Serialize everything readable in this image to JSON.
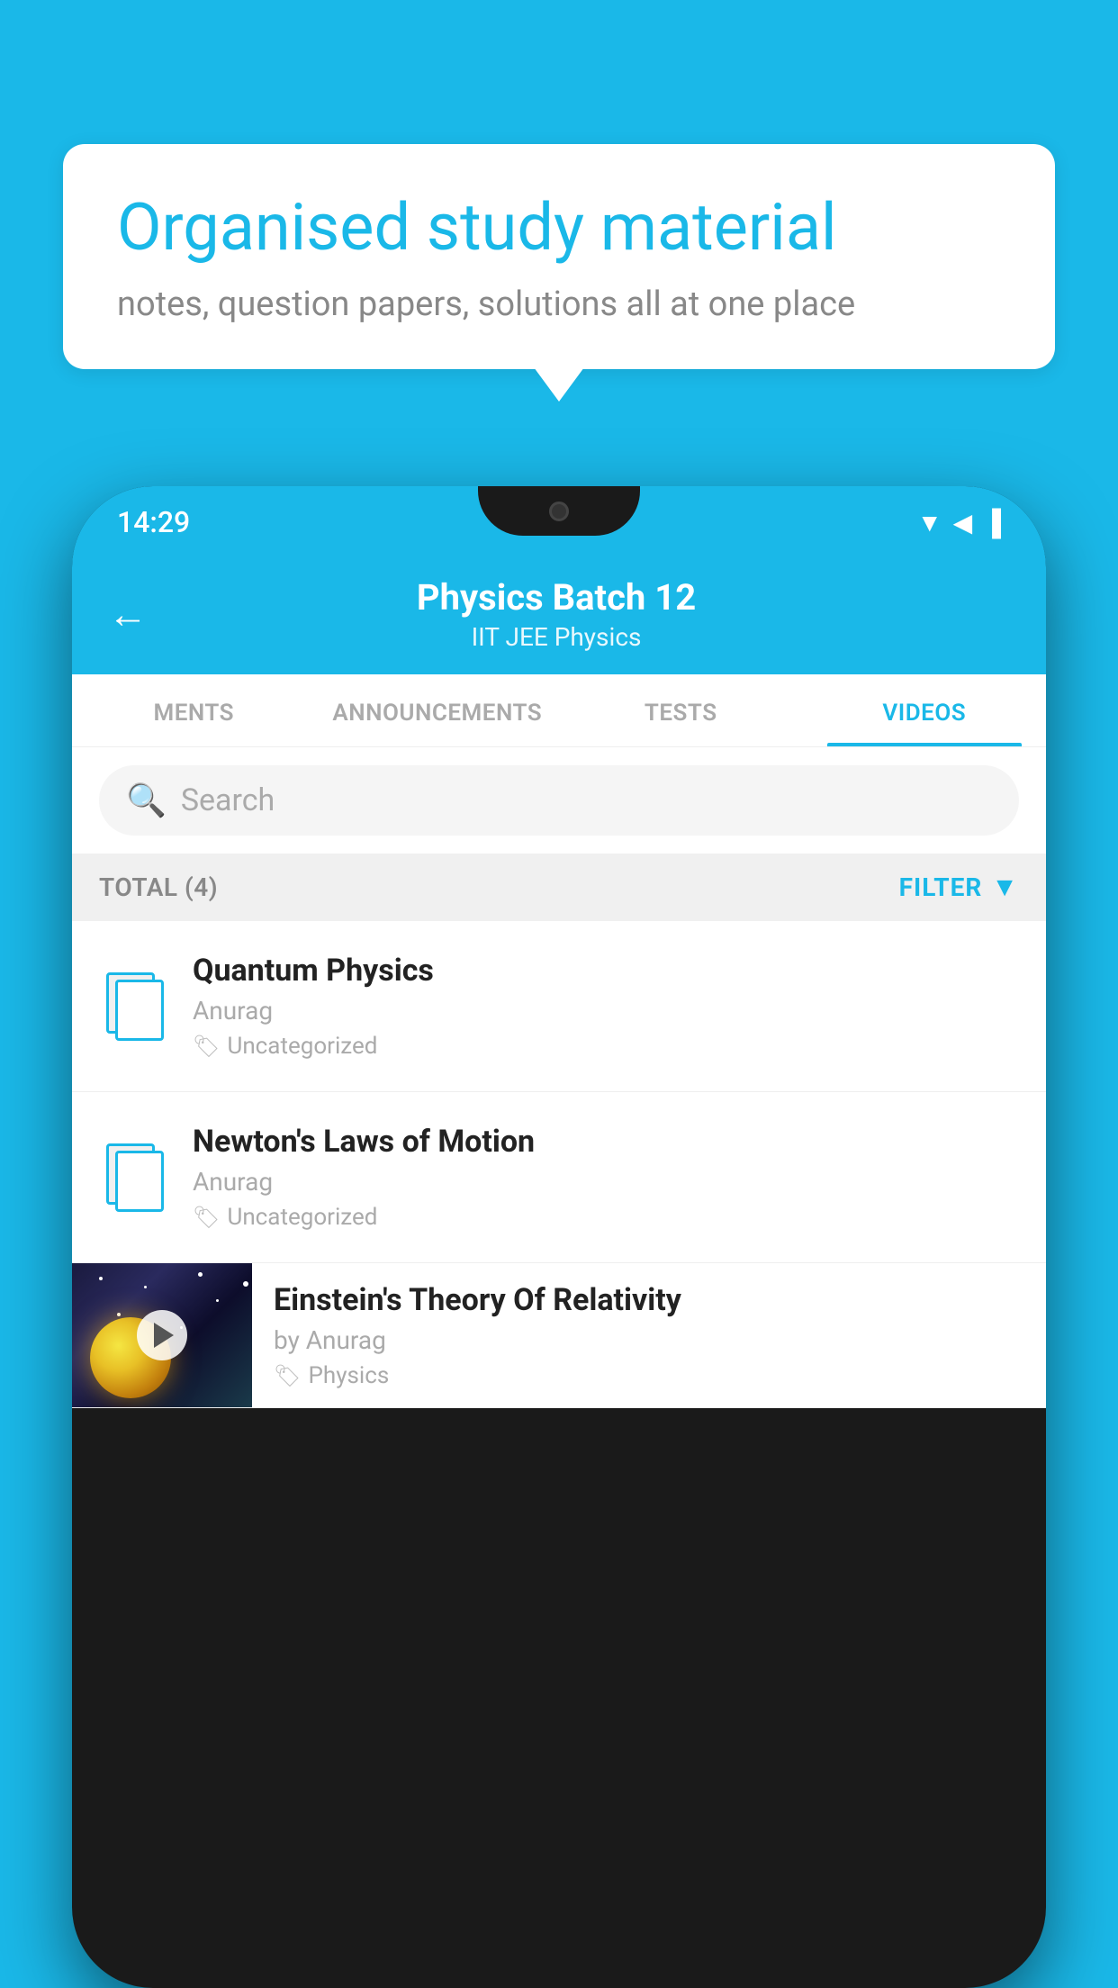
{
  "background_color": "#1ab8e8",
  "bubble": {
    "title": "Organised study material",
    "subtitle": "notes, question papers, solutions all at one place"
  },
  "status_bar": {
    "time": "14:29",
    "icons": [
      "wifi",
      "signal",
      "battery"
    ]
  },
  "app_bar": {
    "back_label": "←",
    "title": "Physics Batch 12",
    "subtitle_tags": "IIT JEE   Physics"
  },
  "tabs": [
    {
      "label": "MENTS",
      "active": false
    },
    {
      "label": "ANNOUNCEMENTS",
      "active": false
    },
    {
      "label": "TESTS",
      "active": false
    },
    {
      "label": "VIDEOS",
      "active": true
    }
  ],
  "search": {
    "placeholder": "Search"
  },
  "filter_bar": {
    "total_label": "TOTAL (4)",
    "filter_label": "FILTER"
  },
  "videos": [
    {
      "title": "Quantum Physics",
      "author": "Anurag",
      "tag": "Uncategorized",
      "has_thumbnail": false
    },
    {
      "title": "Newton's Laws of Motion",
      "author": "Anurag",
      "tag": "Uncategorized",
      "has_thumbnail": false
    },
    {
      "title": "Einstein's Theory Of Relativity",
      "author": "by Anurag",
      "tag": "Physics",
      "has_thumbnail": true
    }
  ]
}
